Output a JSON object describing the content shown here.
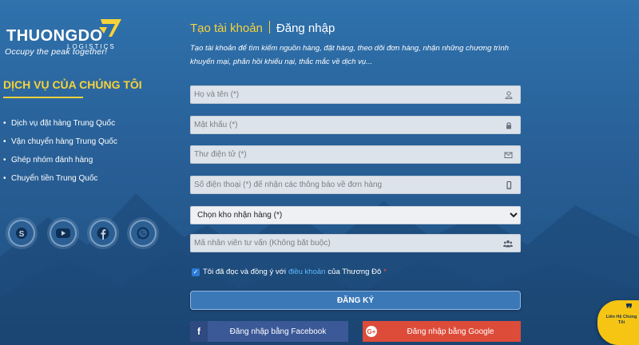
{
  "brand": {
    "logo_text": "THUONGDO",
    "logo_sub": "LOGISTICS",
    "tagline": "Occupy the peak together!"
  },
  "services": {
    "title": "DỊCH VỤ CỦA CHÚNG TÔI",
    "items": [
      "Dịch vụ đặt hàng Trung Quốc",
      "Vận chuyển hàng Trung Quốc",
      "Ghép nhóm đánh hàng",
      "Chuyển tiền Trung Quốc"
    ]
  },
  "social": [
    {
      "name": "skype",
      "icon": "skype-icon"
    },
    {
      "name": "youtube",
      "icon": "youtube-icon"
    },
    {
      "name": "facebook",
      "icon": "facebook-icon"
    },
    {
      "name": "whatsapp",
      "icon": "whatsapp-icon"
    }
  ],
  "tabs": {
    "signup": "Tạo tài khoản",
    "login": "Đăng nhập"
  },
  "intro": "Tạo tài khoản để tìm kiếm nguồn hàng, đặt hàng, theo dõi đơn hàng, nhận những chương trình khuyến mại, phản hồi khiếu nại, thắc mắc về dịch vụ...",
  "form": {
    "name_placeholder": "Họ và tên (*)",
    "password_placeholder": "Mật khẩu (*)",
    "email_placeholder": "Thư điện tử (*)",
    "phone_placeholder": "Số điện thoại (*) để nhận các thông báo về đơn hàng",
    "warehouse_selected": "Chọn kho nhận hàng (*)",
    "staff_placeholder": "Mã nhân viên tư vấn (Không bắt buộc)",
    "agree_prefix": "Tôi đã đọc và đồng ý với",
    "agree_terms": "điều khoản",
    "agree_suffix": "của Thương Đô",
    "agree_required": "*",
    "agree_checked": true,
    "register_label": "ĐĂNG KÝ",
    "facebook_label": "Đăng nhập bằng Facebook",
    "google_label": "Đăng nhập bằng Google"
  },
  "contact_widget": {
    "label": "Liên Hệ Chúng Tôi"
  },
  "colors": {
    "accent_yellow": "#f7d23a",
    "facebook_blue": "#3b5897",
    "google_red": "#dd4b39",
    "register_blue": "#3b78b8"
  }
}
